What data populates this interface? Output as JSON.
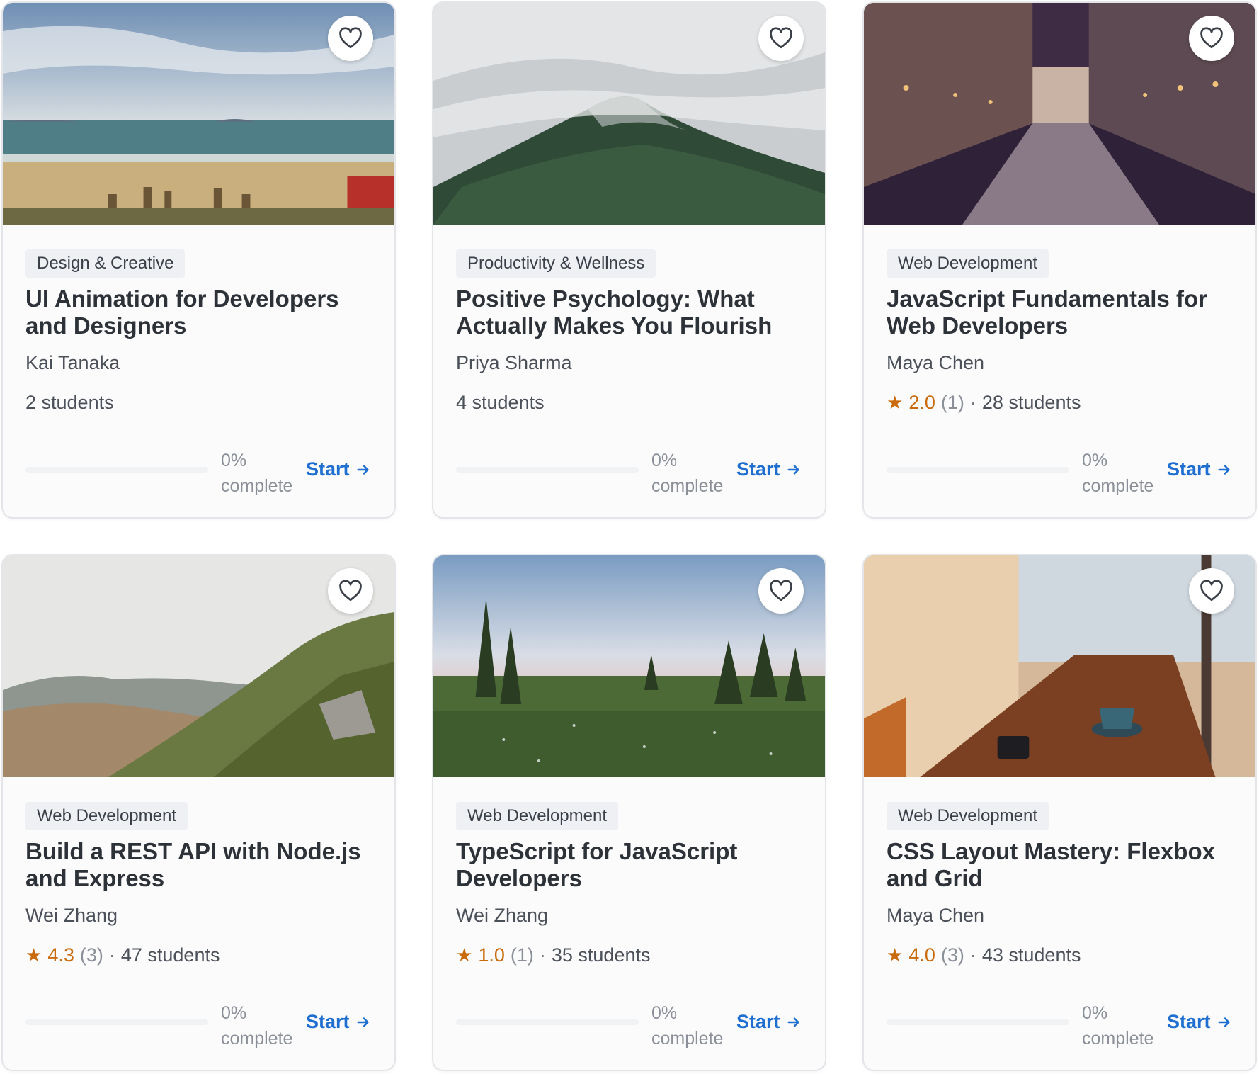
{
  "courses": [
    {
      "category": "Design & Creative",
      "title": "UI Animation for Developers and Designers",
      "instructor": "Kai Tanaka",
      "rating": "",
      "rating_count": "",
      "students": "2 students",
      "progress_percent": 0,
      "progress_label": "0% complete",
      "action_label": "Start",
      "image": "beach-scene"
    },
    {
      "category": "Productivity & Wellness",
      "title": "Positive Psychology: What Actually Makes You Flourish",
      "instructor": "Priya Sharma",
      "rating": "",
      "rating_count": "",
      "students": "4 students",
      "progress_percent": 0,
      "progress_label": "0% complete",
      "action_label": "Start",
      "image": "misty-mountain"
    },
    {
      "category": "Web Development",
      "title": "JavaScript Fundamentals for Web Developers",
      "instructor": "Maya Chen",
      "rating": "2.0",
      "rating_count": "(1)",
      "students": "28 students",
      "progress_percent": 0,
      "progress_label": "0% complete",
      "action_label": "Start",
      "image": "canal-city"
    },
    {
      "category": "Web Development",
      "title": "Build a REST API with Node.js and Express",
      "instructor": "Wei Zhang",
      "rating": "4.3",
      "rating_count": "(3)",
      "students": "47 students",
      "progress_percent": 0,
      "progress_label": "0% complete",
      "action_label": "Start",
      "image": "hill-slope"
    },
    {
      "category": "Web Development",
      "title": "TypeScript for JavaScript Developers",
      "instructor": "Wei Zhang",
      "rating": "1.0",
      "rating_count": "(1)",
      "students": "35 students",
      "progress_percent": 0,
      "progress_label": "0% complete",
      "action_label": "Start",
      "image": "meadow-trees"
    },
    {
      "category": "Web Development",
      "title": "CSS Layout Mastery: Flexbox and Grid",
      "instructor": "Maya Chen",
      "rating": "4.0",
      "rating_count": "(3)",
      "students": "43 students",
      "progress_percent": 0,
      "progress_label": "0% complete",
      "action_label": "Start",
      "image": "cafe-table"
    }
  ],
  "icons": {
    "favorite": "heart-outline-icon",
    "rating": "star-icon",
    "action": "arrow-right-icon"
  },
  "colors": {
    "accent": "#1e6fd0",
    "rating": "#c96a0b",
    "badge_bg": "#eef0f3"
  }
}
